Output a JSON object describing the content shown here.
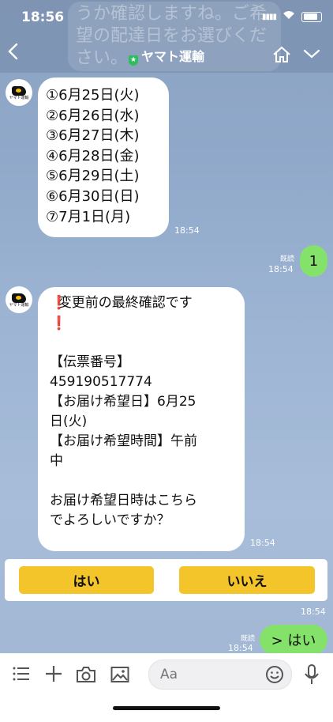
{
  "status": {
    "time": "18:56",
    "signal": "▮▮▮▮",
    "wifi": "◉"
  },
  "header": {
    "ghost_text": "うか確認しますね。ご希望の配達日をお選びください。",
    "back_icon": "chevron-left",
    "title": "ヤマト運輸",
    "home_icon": "home",
    "dropdown_icon": "chevron-down"
  },
  "avatar_label": "ヤマト運輸",
  "list_message": {
    "lines": [
      "①6月25日(火)",
      "②6月26日(水)",
      "③6月27日(木)",
      "④6月28日(金)",
      "⑤6月29日(土)",
      "⑥6月30日(日)",
      "⑦7月1日(月)"
    ],
    "time": "18:54"
  },
  "reply1": {
    "read": "既読",
    "time": "18:54",
    "text": "1"
  },
  "confirm_message": {
    "text": "  変更前の最終確認です\n\n\n【伝票番号】\n459190517774\n【お届け希望日】6月25\n日(火)\n【お届け希望時間】午前\n中\n\nお届け希望日時はこちら\nでよろしいですか？",
    "time": "18:54"
  },
  "quick_reply": {
    "yes": "はい",
    "no": "いいえ",
    "time": "18:54"
  },
  "reply2": {
    "read": "既読",
    "time": "18:54",
    "text": "> はい"
  },
  "input": {
    "placeholder": "Aa"
  }
}
